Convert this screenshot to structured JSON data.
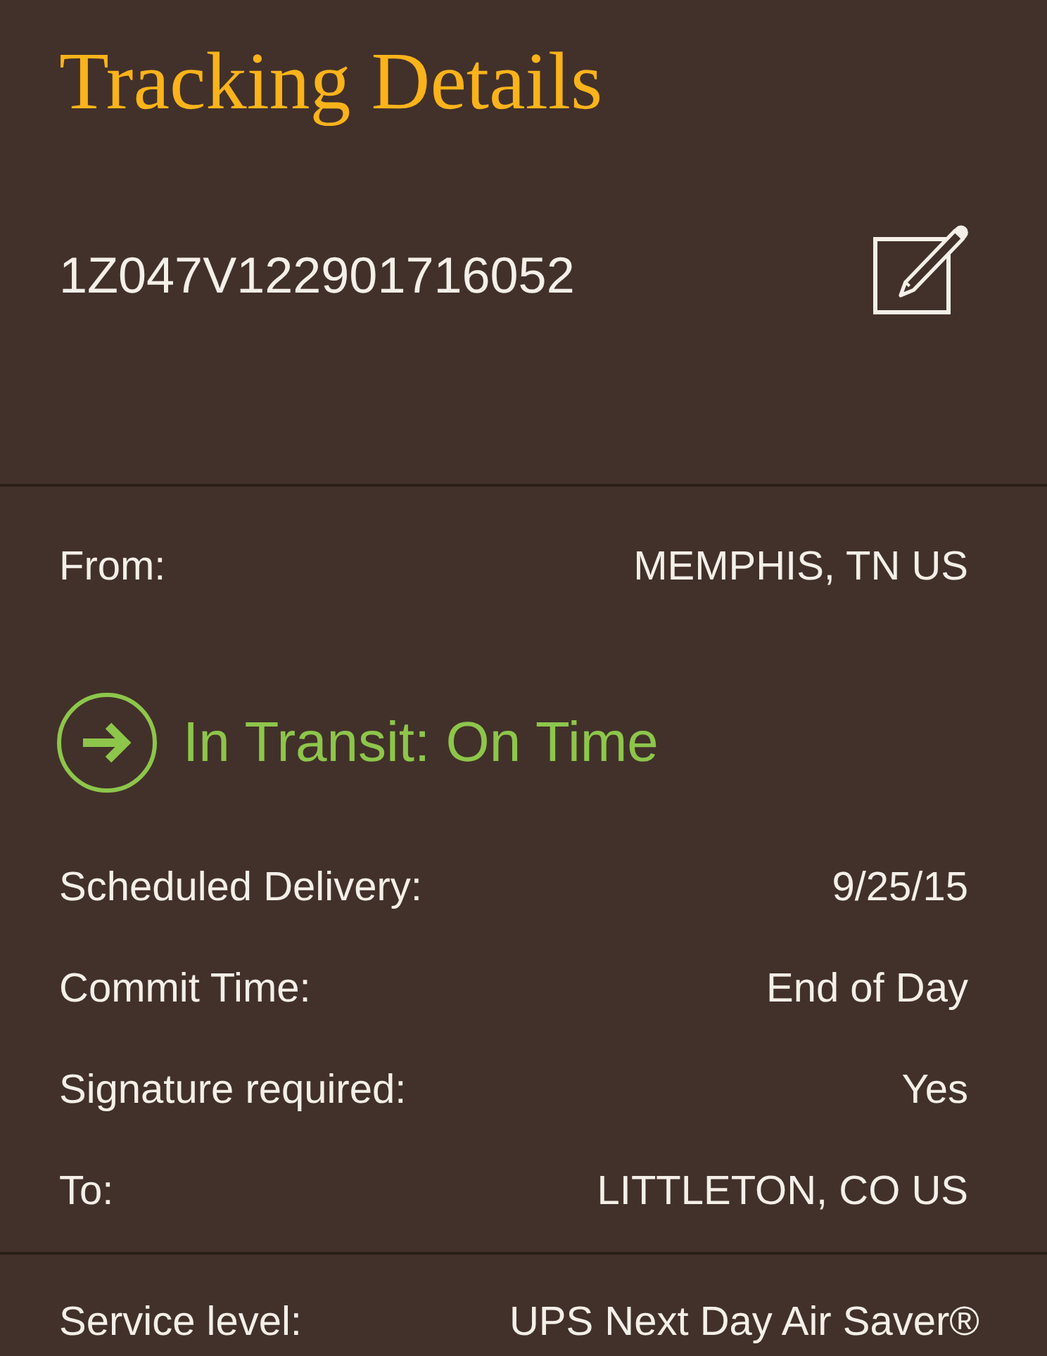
{
  "header": {
    "title": "Tracking Details",
    "tracking_number": "1Z047V122901716052"
  },
  "origin": {
    "label": "From:",
    "value": "MEMPHIS, TN US"
  },
  "status": {
    "text": "In Transit: On Time"
  },
  "details": [
    {
      "label": "Scheduled Delivery:",
      "value": "9/25/15"
    },
    {
      "label": "Commit Time:",
      "value": "End of Day"
    },
    {
      "label": "Signature required:",
      "value": "Yes"
    },
    {
      "label": "To:",
      "value": "LITTLETON, CO US"
    }
  ],
  "service": {
    "label": "Service level:",
    "value": "UPS Next Day Air Saver®"
  }
}
